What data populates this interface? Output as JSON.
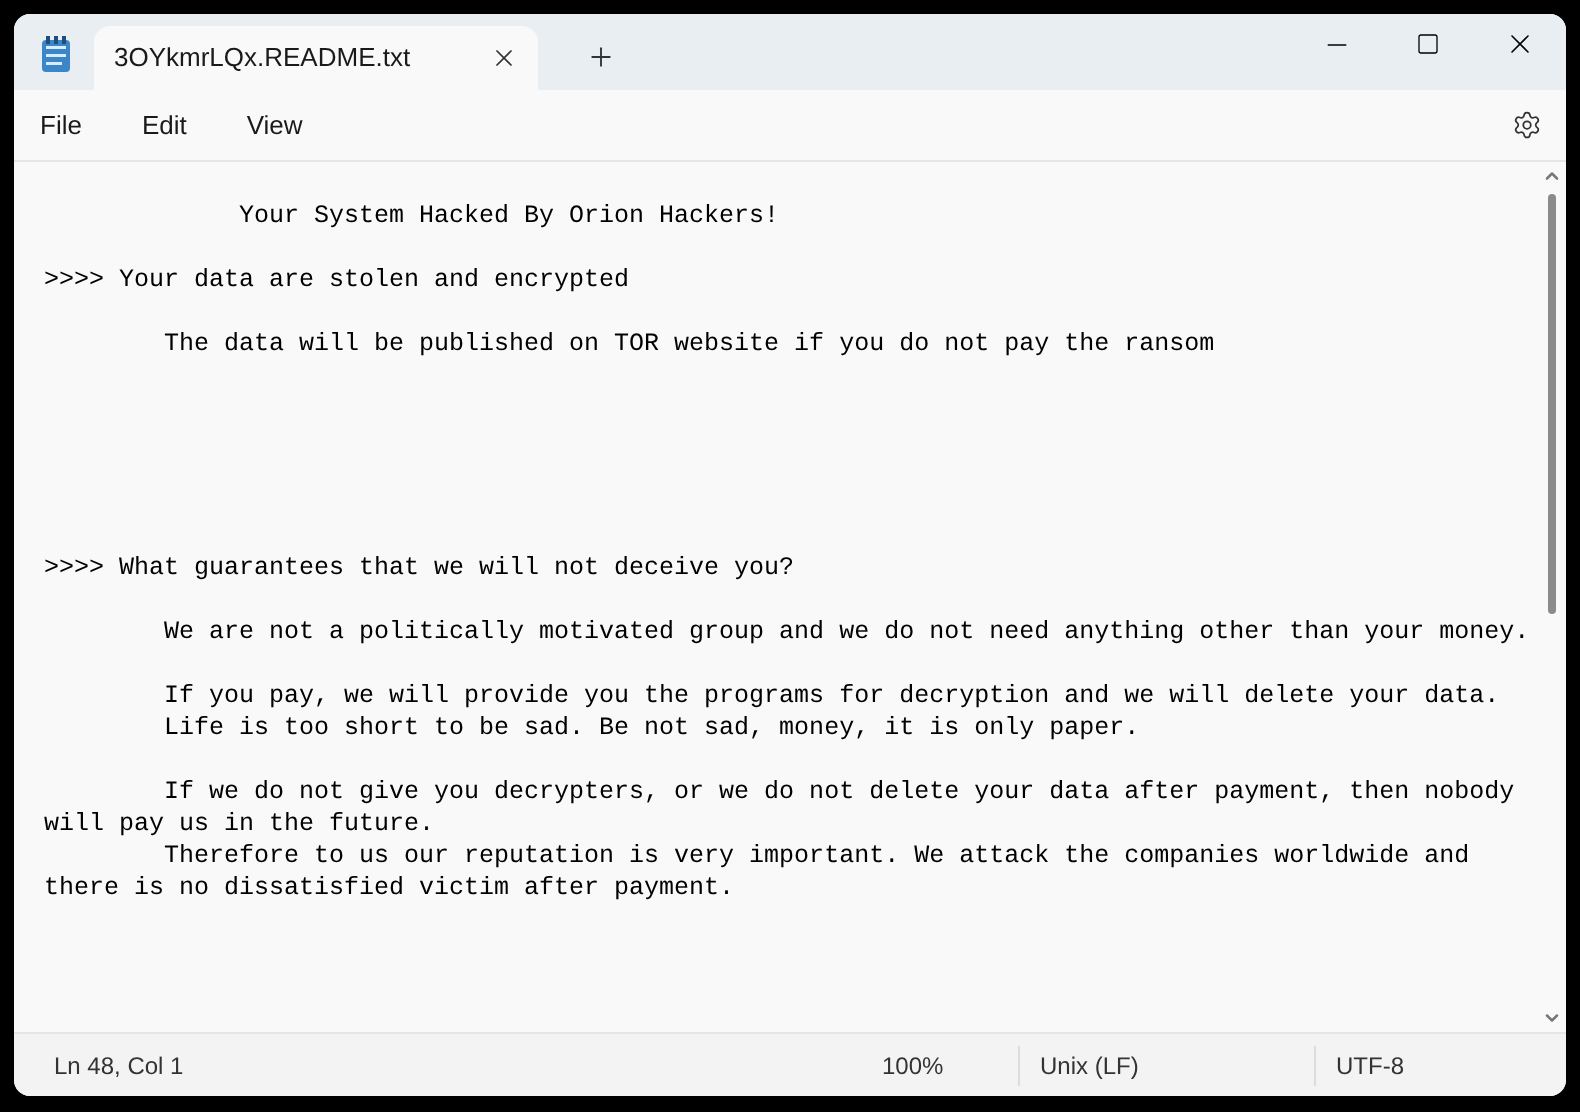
{
  "tabs": [
    {
      "label": "3OYkmrLQx.README.txt",
      "selected": true
    }
  ],
  "menu": [
    "File",
    "Edit",
    "View"
  ],
  "document": {
    "text": "             Your System Hacked By Orion Hackers!\n\n>>>> Your data are stolen and encrypted\n\n        The data will be published on TOR website if you do not pay the ransom\n\n\n\n\n\n\n>>>> What guarantees that we will not deceive you?\n\n        We are not a politically motivated group and we do not need anything other than your money.\n\n        If you pay, we will provide you the programs for decryption and we will delete your data.\n        Life is too short to be sad. Be not sad, money, it is only paper.\n\n        If we do not give you decrypters, or we do not delete your data after payment, then nobody\nwill pay us in the future.\n        Therefore to us our reputation is very important. We attack the companies worldwide and\nthere is no dissatisfied victim after payment."
  },
  "status_bar": [
    "Ln 48, Col 1",
    "100%",
    "Unix (LF)",
    "UTF-8"
  ]
}
